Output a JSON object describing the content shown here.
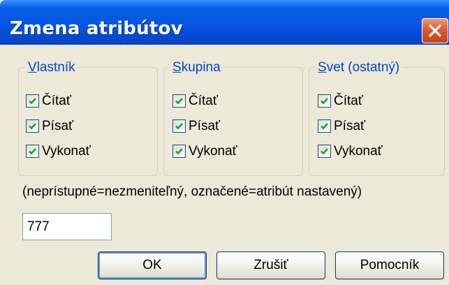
{
  "dialog": {
    "title": "Zmena atribútov",
    "close_icon": "close-icon"
  },
  "groups": [
    {
      "legend_accel": "V",
      "legend_rest": "lastník",
      "items": [
        {
          "label": "Čítať",
          "checked": true
        },
        {
          "label": "Písať",
          "checked": true
        },
        {
          "label": "Vykonať",
          "checked": true
        }
      ]
    },
    {
      "legend_accel": "S",
      "legend_rest": "kupina",
      "items": [
        {
          "label": "Čítať",
          "checked": true
        },
        {
          "label": "Písať",
          "checked": true
        },
        {
          "label": "Vykonať",
          "checked": true
        }
      ]
    },
    {
      "legend_accel": "S",
      "legend_rest": "vet (ostatný)",
      "items": [
        {
          "label": "Čítať",
          "checked": true
        },
        {
          "label": "Písať",
          "checked": true
        },
        {
          "label": "Vykonať",
          "checked": true
        }
      ]
    }
  ],
  "hint": "(neprístupné=nezmeniteľný, označené=atribút nastavený)",
  "octal_input": {
    "value": "777"
  },
  "buttons": {
    "ok": "OK",
    "cancel": "Zrušiť",
    "help": "Pomocník"
  },
  "colors": {
    "titlebar": "#0556e0",
    "legend_text": "#0046d5",
    "face": "#ece9d8",
    "check": "#21a121"
  }
}
